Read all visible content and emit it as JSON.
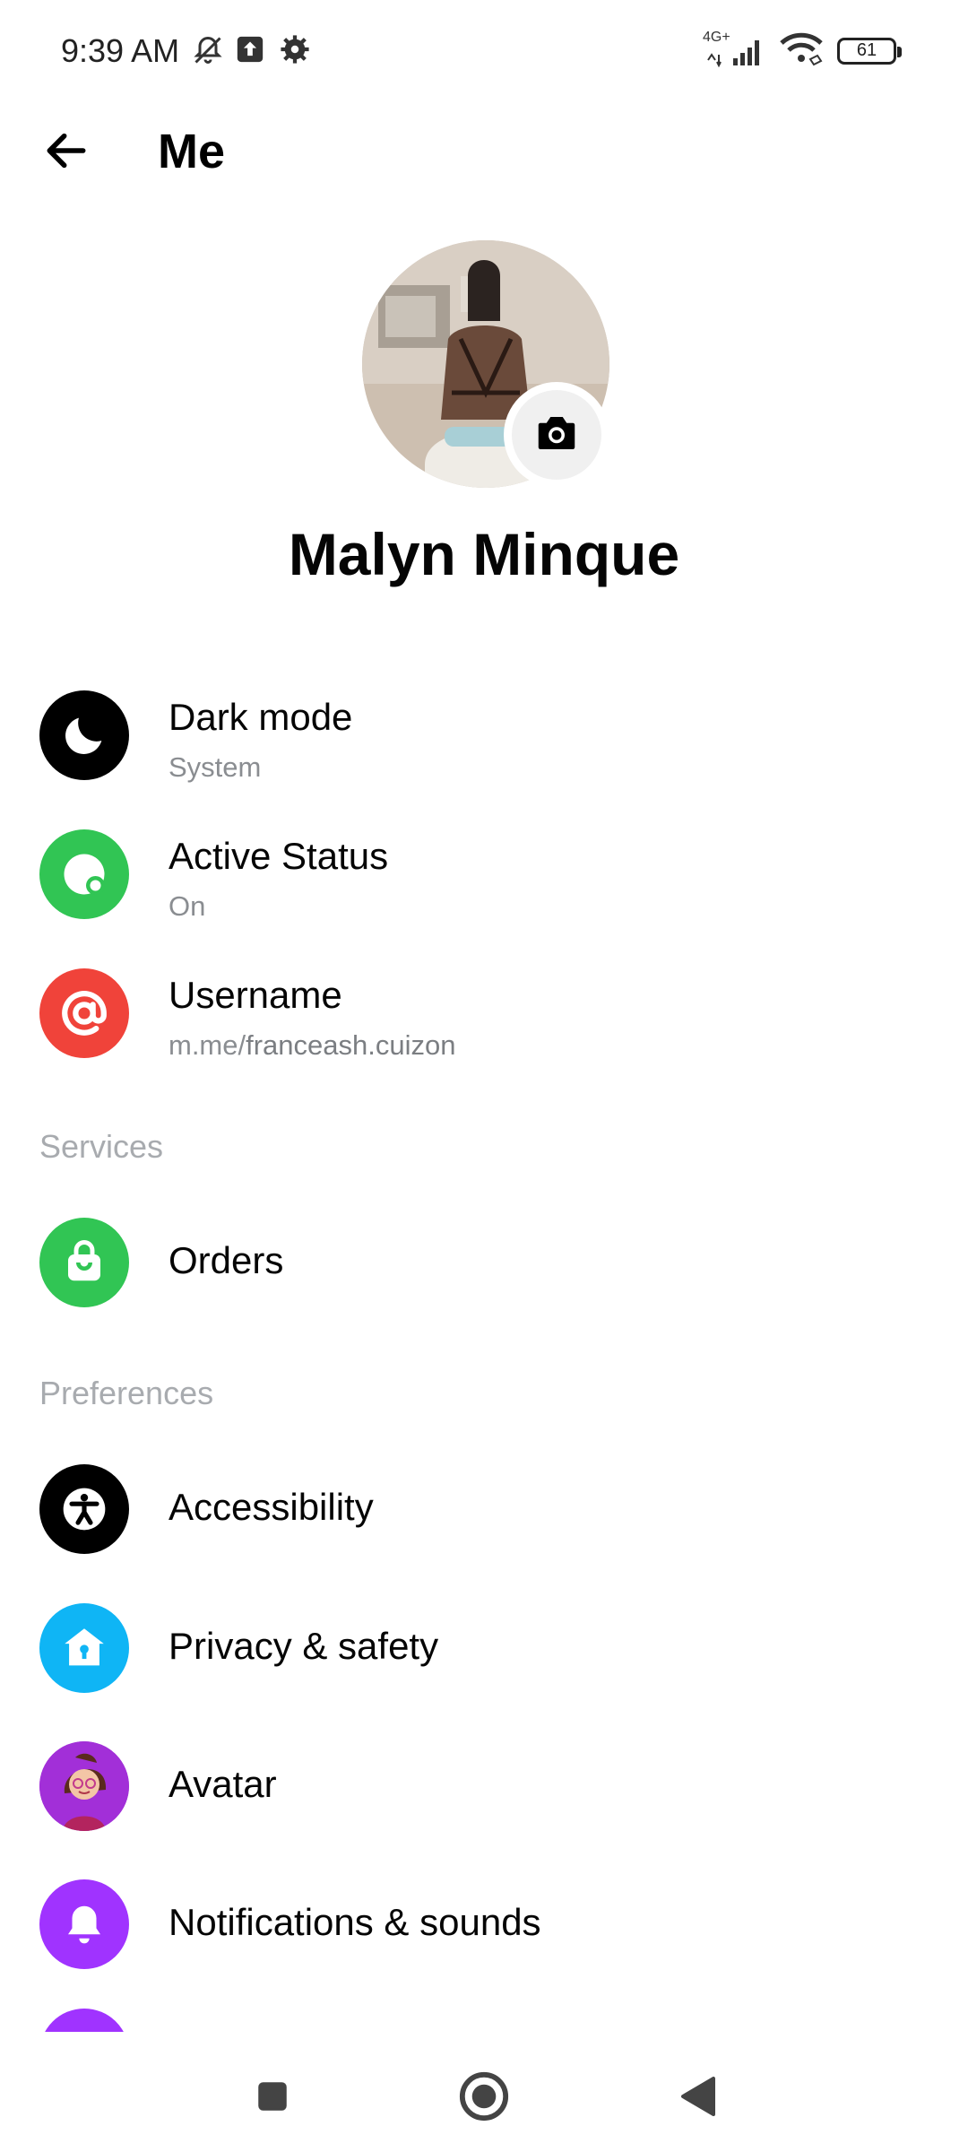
{
  "status_bar": {
    "time": "9:39 AM",
    "network": "4G+",
    "battery": "61"
  },
  "header": {
    "title": "Me"
  },
  "profile": {
    "name": "Malyn Minque"
  },
  "account": [
    {
      "label": "Dark mode",
      "sub": "System",
      "icon": "moon-icon",
      "color": "#000000"
    },
    {
      "label": "Active Status",
      "sub": "On",
      "icon": "active-status-icon",
      "color": "#31c554"
    },
    {
      "label": "Username",
      "sub_prefix": "m.me/",
      "sub_value": "franceash.cuizon",
      "icon": "at-icon",
      "color": "#f0433a"
    }
  ],
  "services": {
    "title": "Services",
    "items": [
      {
        "label": "Orders",
        "icon": "shopping-bag-icon",
        "color": "#31c554"
      }
    ]
  },
  "preferences": {
    "title": "Preferences",
    "items": [
      {
        "label": "Accessibility",
        "icon": "accessibility-icon",
        "color": "#000000"
      },
      {
        "label": "Privacy & safety",
        "icon": "privacy-home-icon",
        "color": "#0fb5f5"
      },
      {
        "label": "Avatar",
        "icon": "avatar-icon",
        "color": "#9b2bd6"
      },
      {
        "label": "Notifications & sounds",
        "icon": "bell-icon",
        "color": "#a033ff"
      }
    ]
  }
}
